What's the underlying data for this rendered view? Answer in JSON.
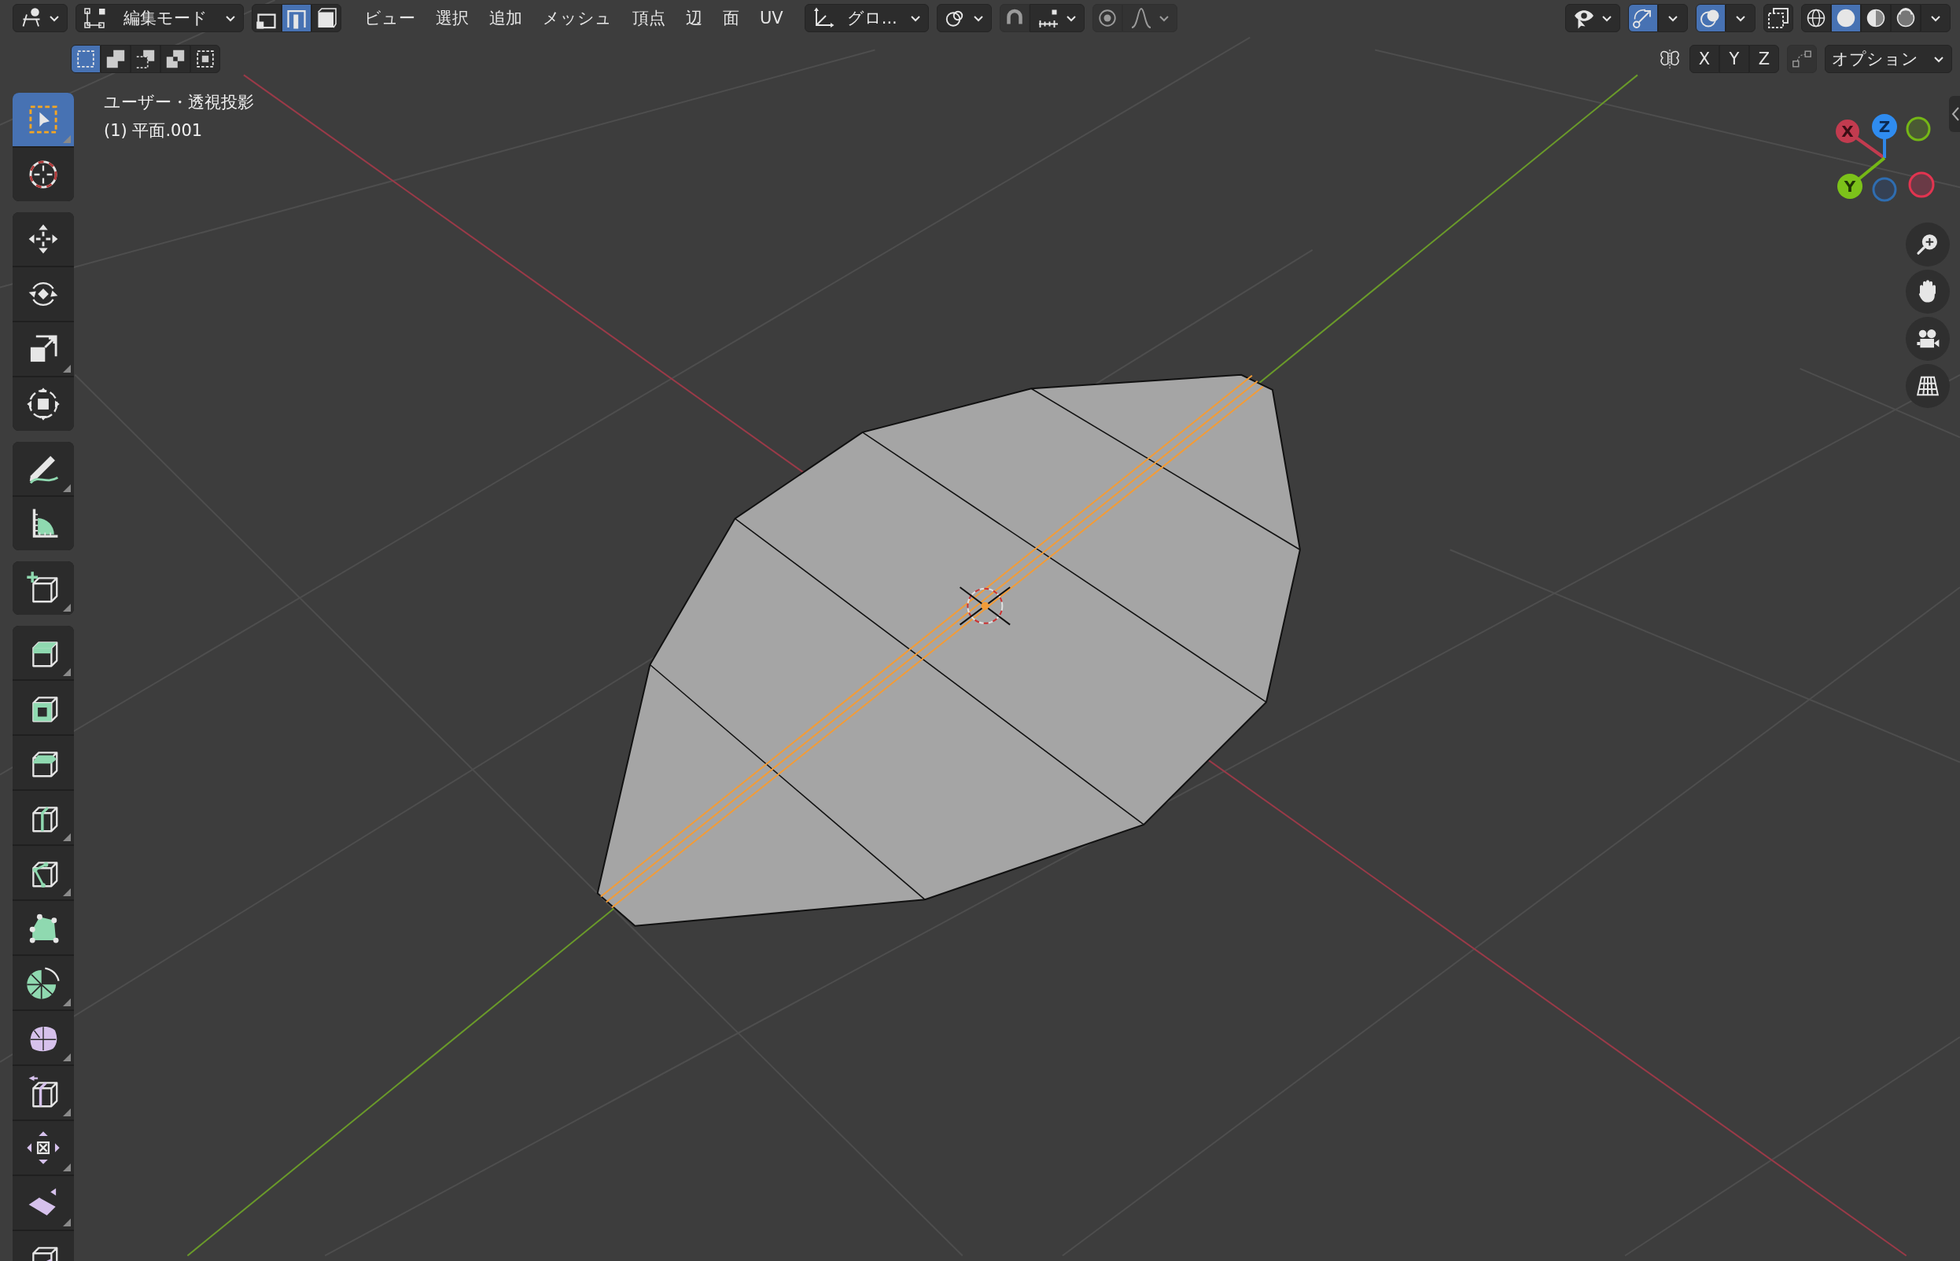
{
  "header": {
    "mode": {
      "label": "編集モード"
    },
    "select_modes": [
      {
        "kind": "vertex",
        "selected": false
      },
      {
        "kind": "edge",
        "selected": true
      },
      {
        "kind": "face",
        "selected": false
      }
    ],
    "menus": [
      "ビュー",
      "選択",
      "追加",
      "メッシュ",
      "頂点",
      "辺",
      "面",
      "UV"
    ],
    "orientation": {
      "label": "グロ..."
    },
    "snap": {
      "on": false
    },
    "proportional_editing": {
      "on": false
    },
    "gizmos": {
      "on": true
    },
    "overlays": {
      "on": true
    },
    "xray": {
      "on": false
    },
    "shading_modes": [
      {
        "kind": "wireframe",
        "selected": false
      },
      {
        "kind": "solid",
        "selected": true
      },
      {
        "kind": "material",
        "selected": false
      },
      {
        "kind": "rendered",
        "selected": false
      }
    ]
  },
  "tool_settings": {
    "box_select_modes": [
      {
        "kind": "set",
        "selected": true
      },
      {
        "kind": "extend",
        "selected": false
      },
      {
        "kind": "subtract",
        "selected": false
      },
      {
        "kind": "invert",
        "selected": false
      },
      {
        "kind": "intersect",
        "selected": false
      }
    ],
    "mirror_axes": [
      {
        "label": "X",
        "on": false
      },
      {
        "label": "Y",
        "on": false
      },
      {
        "label": "Z",
        "on": false
      }
    ],
    "options": "オプション"
  },
  "viewport": {
    "view_name": "ユーザー・透視投影",
    "object_label": "(1) 平面.001",
    "gizmo_axes": [
      "X",
      "Y",
      "Z"
    ]
  },
  "tools": [
    {
      "kind": "select_box",
      "selected": true,
      "submenu": true
    },
    {
      "kind": "cursor",
      "selected": false,
      "submenu": false
    },
    {
      "kind": "move",
      "selected": false,
      "submenu": false
    },
    {
      "kind": "rotate",
      "selected": false,
      "submenu": false
    },
    {
      "kind": "scale",
      "selected": false,
      "submenu": true
    },
    {
      "kind": "transform",
      "selected": false,
      "submenu": false
    },
    {
      "kind": "annotate",
      "selected": false,
      "submenu": true
    },
    {
      "kind": "measure",
      "selected": false,
      "submenu": false
    },
    {
      "kind": "add_cube",
      "selected": false,
      "submenu": true
    },
    {
      "kind": "extrude",
      "selected": false,
      "submenu": true
    },
    {
      "kind": "inset",
      "selected": false,
      "submenu": false
    },
    {
      "kind": "bevel",
      "selected": false,
      "submenu": false
    },
    {
      "kind": "loop_cut",
      "selected": false,
      "submenu": true
    },
    {
      "kind": "knife",
      "selected": false,
      "submenu": true
    },
    {
      "kind": "poly_build",
      "selected": false,
      "submenu": false
    },
    {
      "kind": "spin",
      "selected": false,
      "submenu": true
    },
    {
      "kind": "smooth",
      "selected": false,
      "submenu": true
    },
    {
      "kind": "edge_slide",
      "selected": false,
      "submenu": true
    },
    {
      "kind": "shrink_fatten",
      "selected": false,
      "submenu": true
    },
    {
      "kind": "shear",
      "selected": false,
      "submenu": true
    },
    {
      "kind": "rip",
      "selected": false,
      "submenu": false
    }
  ]
}
